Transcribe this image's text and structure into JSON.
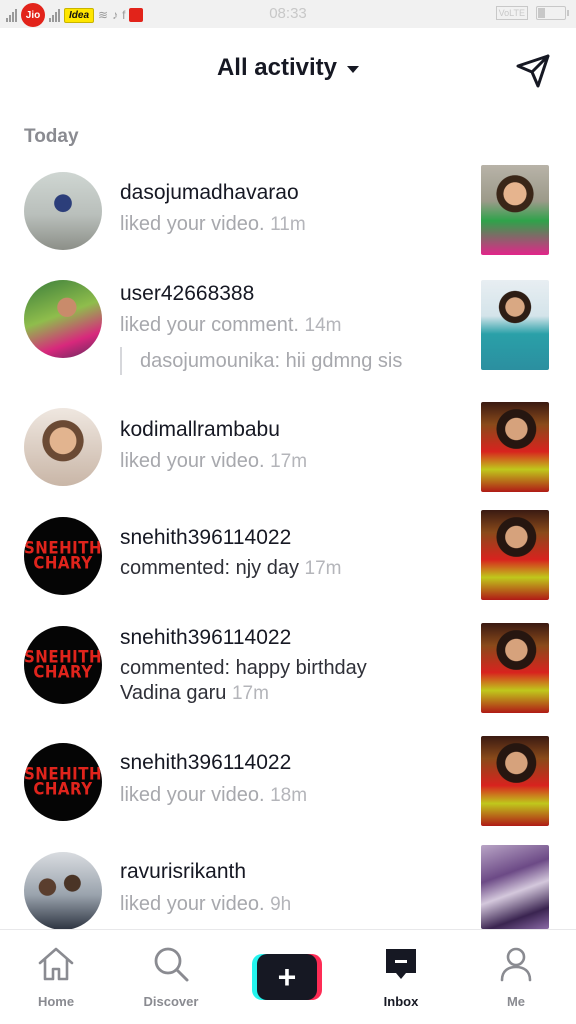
{
  "status_bar": {
    "carrier1": "Jio",
    "carrier2": "Idea",
    "time": "08:33",
    "volte": "VoLTE",
    "battery_level": 0.25
  },
  "header": {
    "title": "All activity"
  },
  "section_today": "Today",
  "notifications": [
    {
      "username": "dasojumadhavarao",
      "text": "liked your video.",
      "time": "11m"
    },
    {
      "username": "user42668388",
      "text": "liked your comment.",
      "time": "14m",
      "quote": "dasojumounika: hii gdmng sis"
    },
    {
      "username": "kodimallrambabu",
      "text": "liked your video.",
      "time": "17m"
    },
    {
      "username": "snehith396114022",
      "text": "commented: njy day",
      "time": "17m",
      "avatar_text_1": "SNEHITH",
      "avatar_text_2": "CHARY"
    },
    {
      "username": "snehith396114022",
      "text_line1": "commented: happy birthday",
      "text_line2": "Vadina garu",
      "time": "17m",
      "avatar_text_1": "SNEHITH",
      "avatar_text_2": "CHARY"
    },
    {
      "username": "snehith396114022",
      "text": "liked your video.",
      "time": "18m",
      "avatar_text_1": "SNEHITH",
      "avatar_text_2": "CHARY"
    },
    {
      "username": "ravurisrikanth",
      "text": "liked your video.",
      "time": "9h"
    }
  ],
  "bottom_nav": {
    "home": "Home",
    "discover": "Discover",
    "create": "+",
    "inbox": "Inbox",
    "me": "Me"
  },
  "colors": {
    "accent_cyan": "#25f4ee",
    "accent_red": "#fe2c55",
    "text_primary": "#161823",
    "text_secondary": "#a7a8ad"
  }
}
